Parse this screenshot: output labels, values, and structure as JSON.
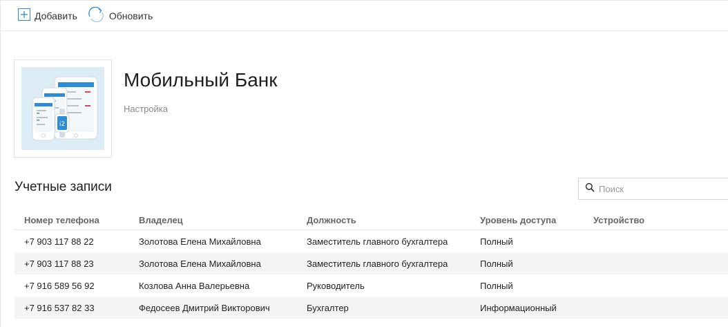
{
  "toolbar": {
    "add_label": "Добавить",
    "refresh_label": "Обновить"
  },
  "app": {
    "title": "Мобильный Банк",
    "subtitle": "Настройка",
    "image_icon": "mobile-devices-illustration"
  },
  "accounts": {
    "title": "Учетные записи",
    "search_placeholder": "Поиск",
    "columns": [
      "Номер телефона",
      "Владелец",
      "Должность",
      "Уровень доступа",
      "Устройство"
    ],
    "rows": [
      [
        "+7 903 117 88 22",
        "Золотова Елена Михайловна",
        "Заместитель главного бухгалтера",
        "Полный",
        ""
      ],
      [
        "+7 903 117 88 23",
        "Золотова Елена Михайловна",
        "Заместитель главного бухгалтера",
        "Полный",
        ""
      ],
      [
        "+7 916 589 56 92",
        "Козлова Анна Валерьевна",
        "Руководитель",
        "Полный",
        ""
      ],
      [
        "+7 916 537 82 33",
        "Федосеев Дмитрий Викторович",
        "Бухгалтер",
        "Информационный",
        ""
      ]
    ]
  },
  "colors": {
    "accent": "#2e8bd6",
    "icon_bg": "#dcecf5",
    "row_alt": "#f4f4f4"
  }
}
